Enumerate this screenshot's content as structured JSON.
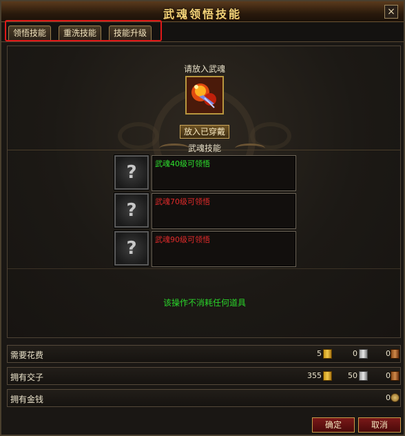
{
  "window": {
    "title": "武魂领悟技能",
    "close_icon": "×"
  },
  "tabs": [
    {
      "label": "领悟技能"
    },
    {
      "label": "重洗技能"
    },
    {
      "label": "技能升级"
    }
  ],
  "soul_panel": {
    "prompt": "请放入武魂",
    "slot_icon": "soul-item-icon",
    "equip_button": "放入已穿戴"
  },
  "skills": {
    "header": "武魂技能",
    "unknown_icon": "?",
    "items": [
      {
        "text": "武魂40级可领悟",
        "color": "#2ee02e"
      },
      {
        "text": "武魂70级可领悟",
        "color": "#e02a2a"
      },
      {
        "text": "武魂90级可领悟",
        "color": "#e02a2a"
      }
    ]
  },
  "notice": "该操作不消耗任何道具",
  "cost_row": {
    "label": "需要花费",
    "gold": "5",
    "silver": "0",
    "bronze": "0"
  },
  "owned_row": {
    "label": "拥有交子",
    "gold": "355",
    "silver": "50",
    "bronze": "0"
  },
  "money_row": {
    "label": "拥有金钱",
    "value": "0"
  },
  "buttons": {
    "confirm": "确定",
    "cancel": "取消"
  }
}
